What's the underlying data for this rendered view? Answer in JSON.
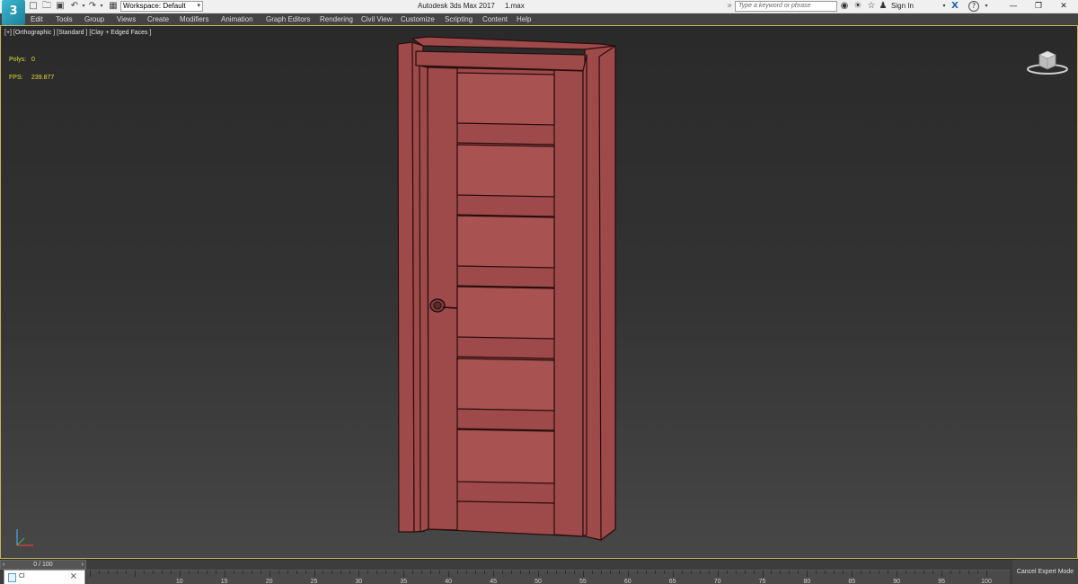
{
  "app": {
    "logo_text": "3",
    "title": "Autodesk 3ds Max 2017     1.max"
  },
  "toolbar": {
    "workspace_label": "Workspace: Default",
    "search_placeholder": "Type a keyword or phrase",
    "signin_label": "Sign In"
  },
  "menu": {
    "items": [
      {
        "label": "Edit"
      },
      {
        "label": "Tools"
      },
      {
        "label": "Group"
      },
      {
        "label": "Views"
      },
      {
        "label": "Create"
      },
      {
        "label": "Modifiers"
      },
      {
        "label": "Animation"
      },
      {
        "label": "Graph Editors"
      },
      {
        "label": "Rendering"
      },
      {
        "label": "Civil View"
      },
      {
        "label": "Customize"
      },
      {
        "label": "Scripting"
      },
      {
        "label": "Content"
      },
      {
        "label": "Help"
      }
    ]
  },
  "viewport": {
    "label": "[+] [Orthographic ] [Standard ] [Clay + Edged Faces ]",
    "stats": {
      "polys_label": "Polys:",
      "polys_value": "0",
      "fps_label": "FPS:",
      "fps_value": "239.877"
    },
    "door_color": "#9e4a4a",
    "edge_color": "#2a0d0d",
    "selection_border_color": "#c8b35a"
  },
  "timeline": {
    "frame_display": "0 / 100",
    "ticks": [
      "10",
      "15",
      "20",
      "25",
      "30",
      "35",
      "40",
      "45",
      "50",
      "55",
      "60",
      "65",
      "70",
      "75",
      "80",
      "85",
      "90",
      "95",
      "100"
    ],
    "cancel_expert_label": "Cancel Expert Mode",
    "listener_text": "Cl"
  },
  "icons": {
    "new": "new-file-icon",
    "open": "open-folder-icon",
    "save": "save-icon",
    "undo": "undo-icon",
    "redo": "redo-icon",
    "project": "project-folder-icon",
    "binoculars": "binoculars-icon",
    "star": "favorites-star-icon",
    "user": "user-icon",
    "exchange": "autodesk-exchange-icon",
    "help": "help-icon"
  }
}
